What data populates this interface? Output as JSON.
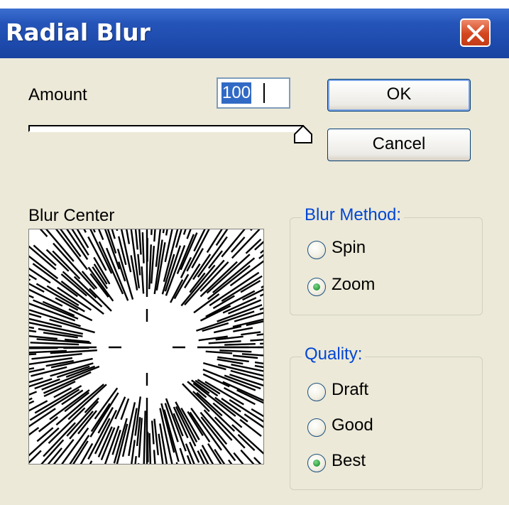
{
  "window": {
    "title": "Radial Blur"
  },
  "amount": {
    "label": "Amount",
    "value": "100",
    "slider_fraction": 1.0
  },
  "buttons": {
    "ok": "OK",
    "cancel": "Cancel"
  },
  "blur_center": {
    "label": "Blur Center"
  },
  "blur_method": {
    "title": "Blur Method:",
    "options": [
      "Spin",
      "Zoom"
    ],
    "selected": "Zoom"
  },
  "quality": {
    "title": "Quality:",
    "options": [
      "Draft",
      "Good",
      "Best"
    ],
    "selected": "Best"
  },
  "colors": {
    "title_bar": "#2554b9",
    "dialog_bg": "#ece9d8",
    "group_title": "#0046d5",
    "radio_dot": "#2b9b3c"
  }
}
